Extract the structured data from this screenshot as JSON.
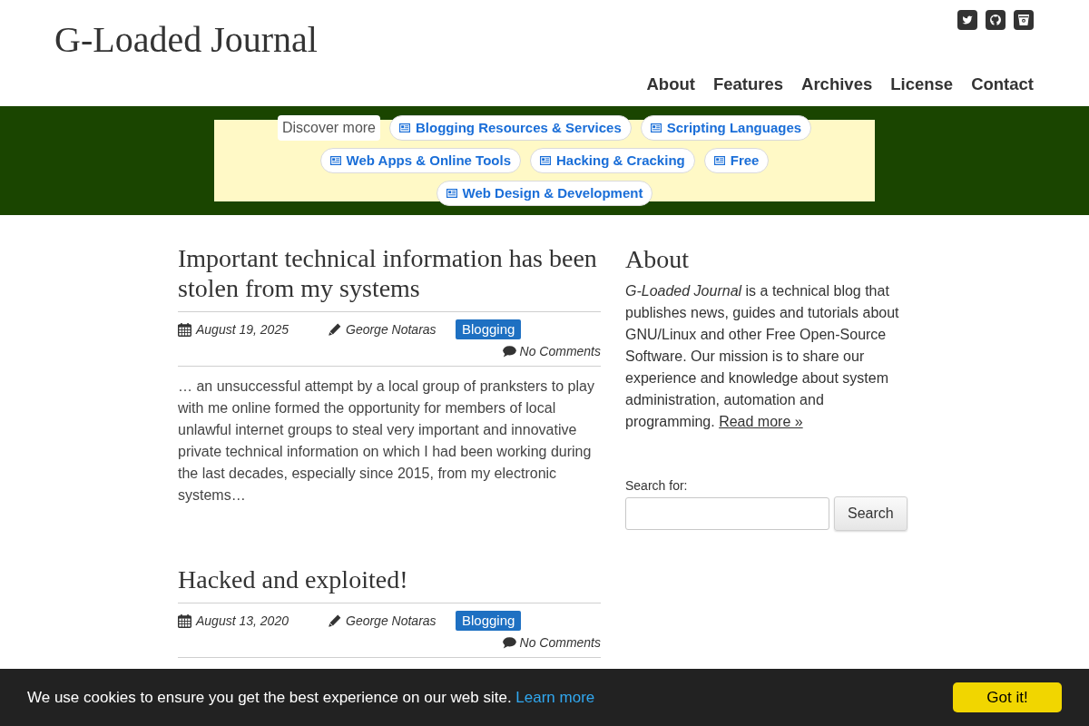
{
  "header": {
    "title": "G-Loaded Journal",
    "nav": [
      {
        "label": "About"
      },
      {
        "label": "Features"
      },
      {
        "label": "Archives"
      },
      {
        "label": "License"
      },
      {
        "label": "Contact"
      }
    ]
  },
  "discover": {
    "label": "Discover more",
    "topics": [
      "Blogging Resources & Services",
      "Scripting Languages",
      "Web Apps & Online Tools",
      "Hacking & Cracking",
      "Free",
      "Web Design & Development"
    ]
  },
  "posts": [
    {
      "title": "Important technical information has been stolen from my systems",
      "date": "August 19, 2025",
      "author": "George Notaras",
      "category": "Blogging",
      "comments": "No Comments",
      "excerpt": "… an unsuccessful attempt by a local group of pranksters to play with me online formed the opportunity for members of local unlawful internet groups to steal very important and innovative private technical information on which I had been working during the last decades, especially since 2015, from my electronic systems…"
    },
    {
      "title": "Hacked and exploited!",
      "date": "August 13, 2020",
      "author": "George Notaras",
      "category": "Blogging",
      "comments": "No Comments"
    }
  ],
  "sidebar": {
    "about": {
      "heading": "About",
      "text": "*G-Loaded Journal* is a technical blog that publishes news, guides and tutorials about GNU/Linux and other Free Open-Source Software. Our mission is to share our experience and knowledge about system administration, automation and programming.",
      "link": "Read more »"
    },
    "search": {
      "label": "Search for:",
      "button": "Search"
    }
  },
  "cookie_banner": {
    "message": "We use cookies to ensure you get the best experience on our web site.",
    "link": "Learn more",
    "button": "Got it!"
  }
}
